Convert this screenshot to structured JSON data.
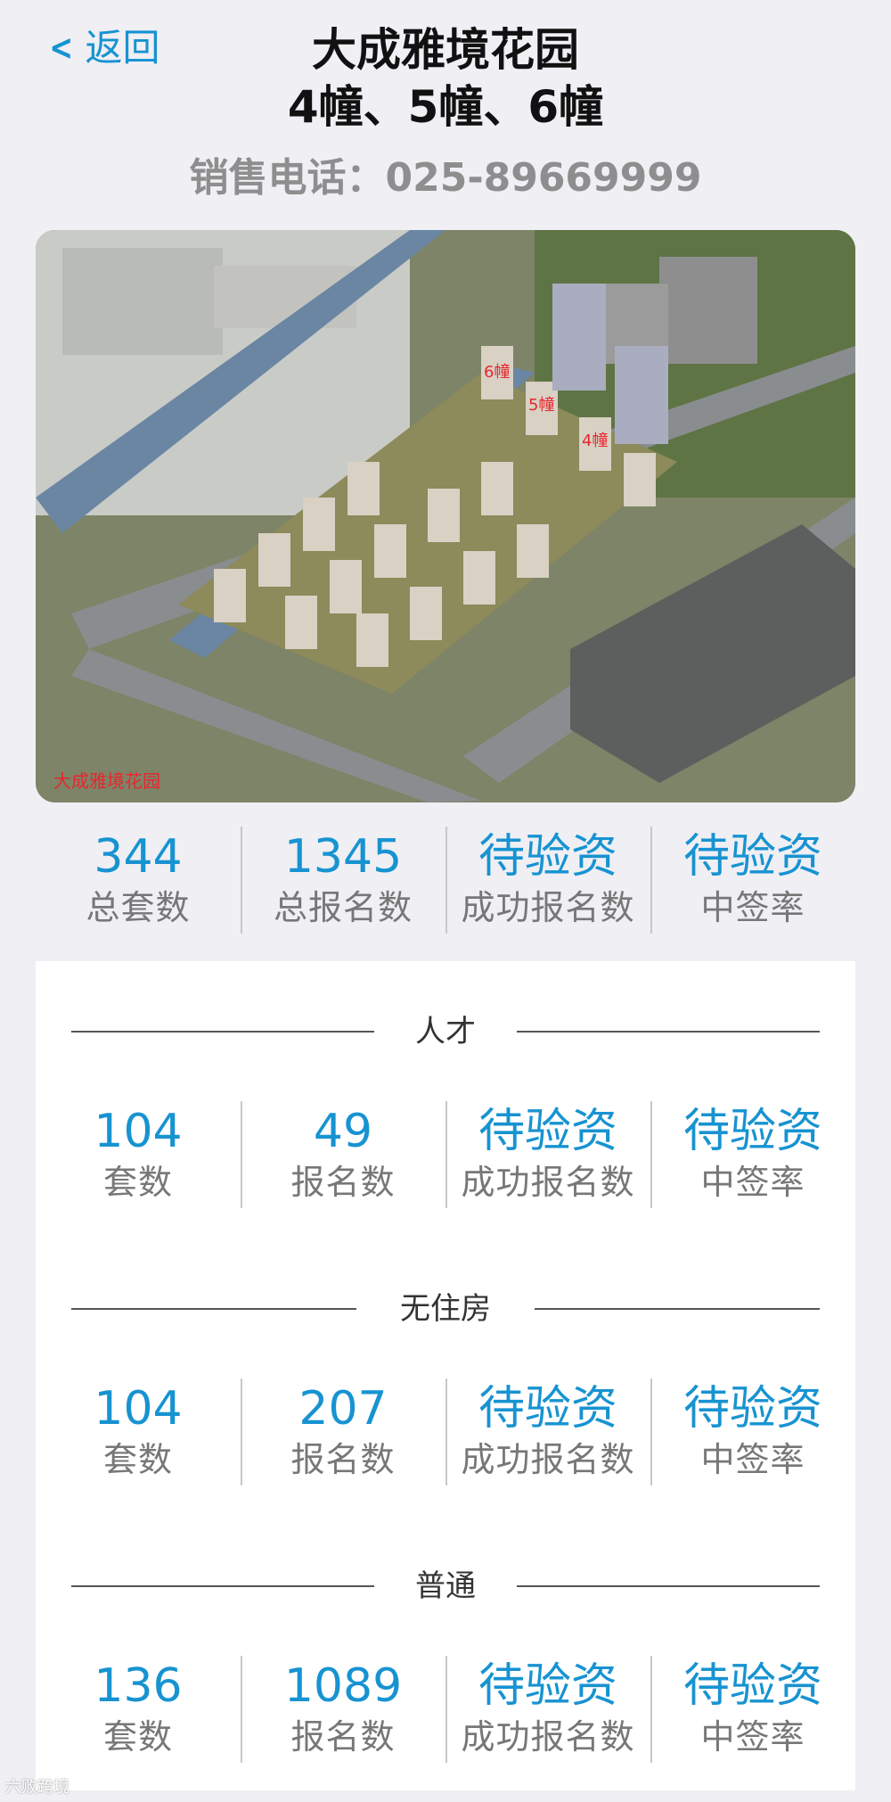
{
  "header": {
    "back_label": "返回",
    "title": "大成雅境花园",
    "subtitle": "4幢、5幢、6幢",
    "phone": "销售电话：025-89669999"
  },
  "aerial": {
    "label_6": "6幢",
    "label_5": "5幢",
    "label_4": "4幢",
    "caption": "大成雅境花园",
    "accent": "#e8262e"
  },
  "summary": [
    {
      "value": "344",
      "label": "总套数"
    },
    {
      "value": "1345",
      "label": "总报名数"
    },
    {
      "value": "待验资",
      "label": "成功报名数"
    },
    {
      "value": "待验资",
      "label": "中签率"
    }
  ],
  "groups": [
    {
      "name": "人才",
      "stats": [
        {
          "value": "104",
          "label": "套数"
        },
        {
          "value": "49",
          "label": "报名数"
        },
        {
          "value": "待验资",
          "label": "成功报名数"
        },
        {
          "value": "待验资",
          "label": "中签率"
        }
      ]
    },
    {
      "name": "无住房",
      "stats": [
        {
          "value": "104",
          "label": "套数"
        },
        {
          "value": "207",
          "label": "报名数"
        },
        {
          "value": "待验资",
          "label": "成功报名数"
        },
        {
          "value": "待验资",
          "label": "中签率"
        }
      ]
    },
    {
      "name": "普通",
      "stats": [
        {
          "value": "136",
          "label": "套数"
        },
        {
          "value": "1089",
          "label": "报名数"
        },
        {
          "value": "待验资",
          "label": "成功报名数"
        },
        {
          "value": "待验资",
          "label": "中签率"
        }
      ]
    }
  ],
  "watermark": "六败跨境",
  "colors": {
    "accent": "#1793d1",
    "muted": "#777777",
    "background": "#efeff4"
  }
}
